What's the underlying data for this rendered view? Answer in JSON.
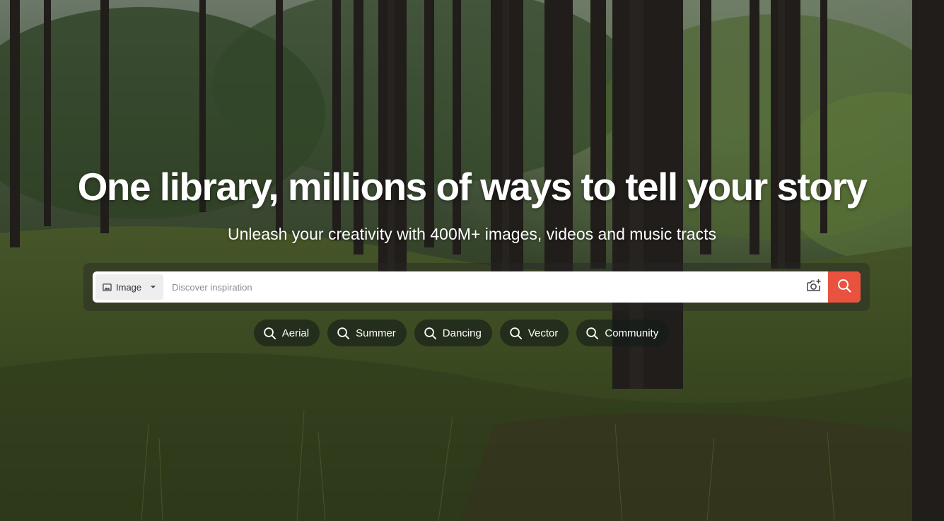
{
  "hero": {
    "headline": "One library, millions of ways to tell your story",
    "subheadline": "Unleash your creativity with 400M+ images, videos and music tracts"
  },
  "search": {
    "type_label": "Image",
    "type_icon": "image-icon",
    "placeholder": "Discover inspiration",
    "value": "",
    "camera_icon": "camera-search-icon",
    "submit_icon": "search-icon",
    "accent_color": "#e8523f"
  },
  "suggestions": [
    {
      "label": "Aerial",
      "icon": "search-icon"
    },
    {
      "label": "Summer",
      "icon": "search-icon"
    },
    {
      "label": "Dancing",
      "icon": "search-icon"
    },
    {
      "label": "Vector",
      "icon": "search-icon"
    },
    {
      "label": "Community",
      "icon": "search-icon"
    }
  ]
}
